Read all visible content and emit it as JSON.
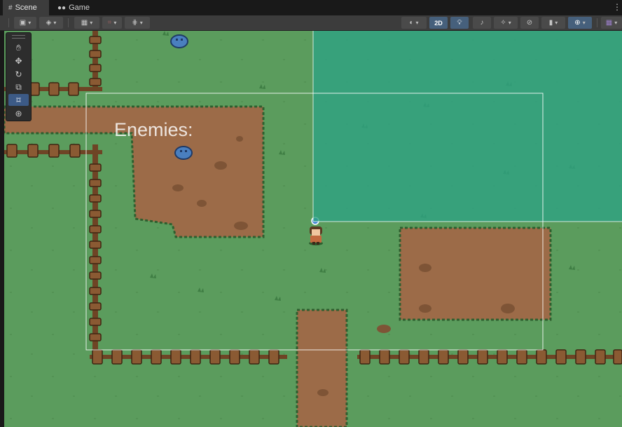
{
  "tabs": [
    {
      "label": "Scene",
      "icon": "grid-icon",
      "active": true
    },
    {
      "label": "Game",
      "icon": "gamepad-icon",
      "active": false
    }
  ],
  "toolbar": {
    "mode_2d_label": "2D"
  },
  "tools": [
    "hand-tool",
    "move-tool",
    "rotate-tool",
    "scale-tool",
    "rect-tool",
    "transform-tool"
  ],
  "selected_tool": "rect-tool",
  "scene": {
    "enemies_label": "Enemies:"
  },
  "colors": {
    "grass": "#5b9c5d",
    "dirt": "#9c6b48",
    "fence": "#6e4425",
    "overlay": "#2ea383"
  }
}
